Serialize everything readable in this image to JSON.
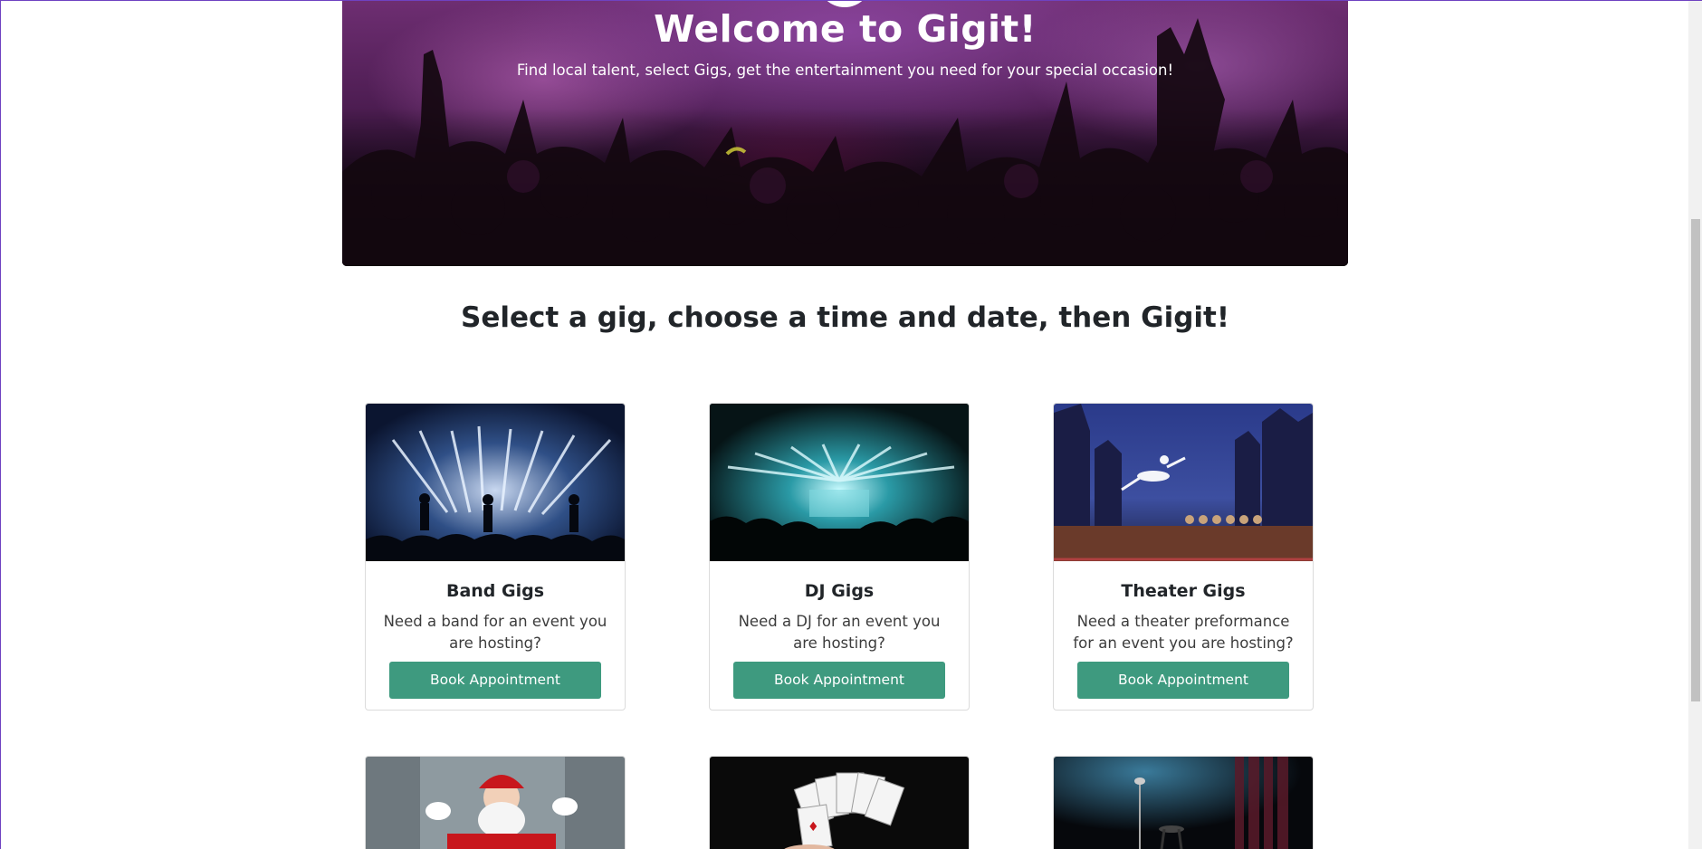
{
  "hero": {
    "title": "Welcome to Gigit!",
    "subtitle": "Find local talent, select Gigs, get the entertainment you need for your special occasion!"
  },
  "section": {
    "heading": "Select a gig, choose a time and date, then Gigit!"
  },
  "cards": [
    {
      "title": "Band Gigs",
      "text": "Need a band for an event you are hosting?",
      "button": "Book Appointment",
      "image": "band-concert-image"
    },
    {
      "title": "DJ Gigs",
      "text": "Need a DJ for an event you are hosting?",
      "button": "Book Appointment",
      "image": "dj-stage-image"
    },
    {
      "title": "Theater Gigs",
      "text": "Need a theater preformance for an event you are hosting?",
      "button": "Book Appointment",
      "image": "ballet-stage-image"
    }
  ],
  "cards_partial": [
    {
      "image": "santa-claus-image"
    },
    {
      "image": "magic-cards-image"
    },
    {
      "image": "comedy-stage-image"
    }
  ],
  "colors": {
    "accent": "#3e9a7f",
    "hero_purple": "#6e2e72"
  }
}
